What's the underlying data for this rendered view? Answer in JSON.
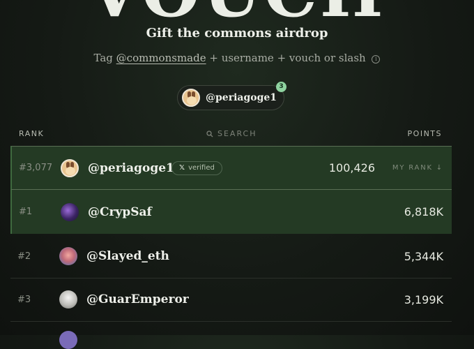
{
  "hero": {
    "title": "VOUCH"
  },
  "subtitle": "Gift the commons airdrop",
  "tagline": {
    "prefix": "Tag ",
    "handle": "@commonsmade",
    "suffix": " + username + vouch or slash",
    "info_icon": "info-icon"
  },
  "profile_pill": {
    "username": "@periagoge1",
    "badge_count": "3"
  },
  "columns": {
    "rank": "RANK",
    "search_placeholder": "SEARCH",
    "points": "POINTS"
  },
  "my_row": {
    "rank": "#3,077",
    "username": "@periagoge1",
    "verified_label": "verified",
    "points": "100,426",
    "my_rank_label": "MY RANK ↓"
  },
  "leaderboard": [
    {
      "rank": "#1",
      "username": "@CrypSaf",
      "points": "6,818K"
    },
    {
      "rank": "#2",
      "username": "@Slayed_eth",
      "points": "5,344K"
    },
    {
      "rank": "#3",
      "username": "@GuarEmperor",
      "points": "3,199K"
    }
  ],
  "colors": {
    "background": "#151a15",
    "highlight_row": "#243a24",
    "badge": "#8fd3a0",
    "accent_border": "#3f6a3f"
  }
}
